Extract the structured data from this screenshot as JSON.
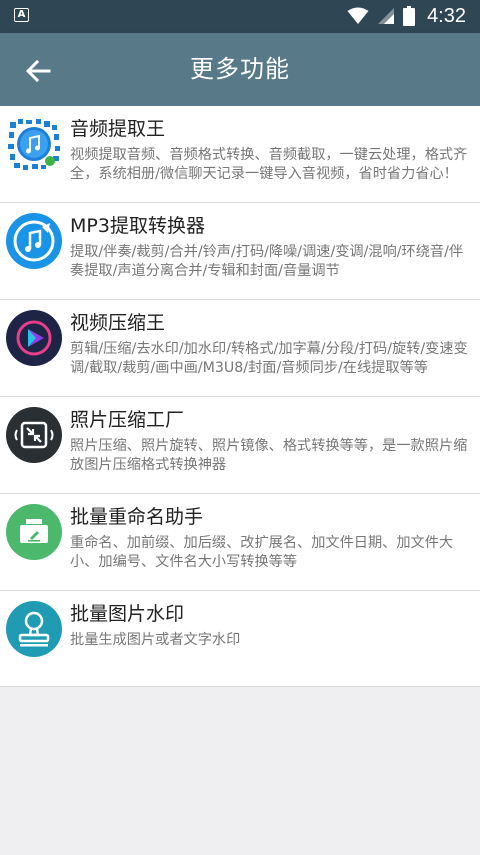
{
  "status_bar": {
    "notification_badge": "A",
    "time": "4:32"
  },
  "app_bar": {
    "title": "更多功能"
  },
  "items": [
    {
      "name": "音频提取王",
      "desc": "视频提取音频、音频格式转换、音频截取，一键云处理，格式齐全，系统相册/微信聊天记录一键导入音视频，省时省力省心！",
      "icon": "qr-code-music-icon",
      "color": "#1e7fd8"
    },
    {
      "name": "MP3提取转换器",
      "desc": "提取/伴奏/裁剪/合并/铃声/打码/降噪/调速/变调/混响/环绕音/伴奏提取/声道分离合并/专辑和封面/音量调节",
      "icon": "music-note-icon",
      "color": "#1a94e6"
    },
    {
      "name": "视频压缩王",
      "desc": "剪辑/压缩/去水印/加水印/转格式/加字幕/分段/打码/旋转/变速变调/截取/裁剪/画中画/M3U8/封面/音频同步/在线提取等等",
      "icon": "video-play-icon",
      "color": "#1e2446"
    },
    {
      "name": "照片压缩工厂",
      "desc": "照片压缩、照片旋转、照片镜像、格式转换等等，是一款照片缩放图片压缩格式转换神器",
      "icon": "compress-arrows-icon",
      "color": "#2a2f33"
    },
    {
      "name": "批量重命名助手",
      "desc": "重命名、加前缀、加后缀、改扩展名、加文件日期、加文件大小、加编号、文件名大小写转换等等",
      "icon": "rename-edit-icon",
      "color": "#4cb86b"
    },
    {
      "name": "批量图片水印",
      "desc": "批量生成图片或者文字水印",
      "icon": "stamp-icon",
      "color": "#1f9bb3"
    }
  ]
}
